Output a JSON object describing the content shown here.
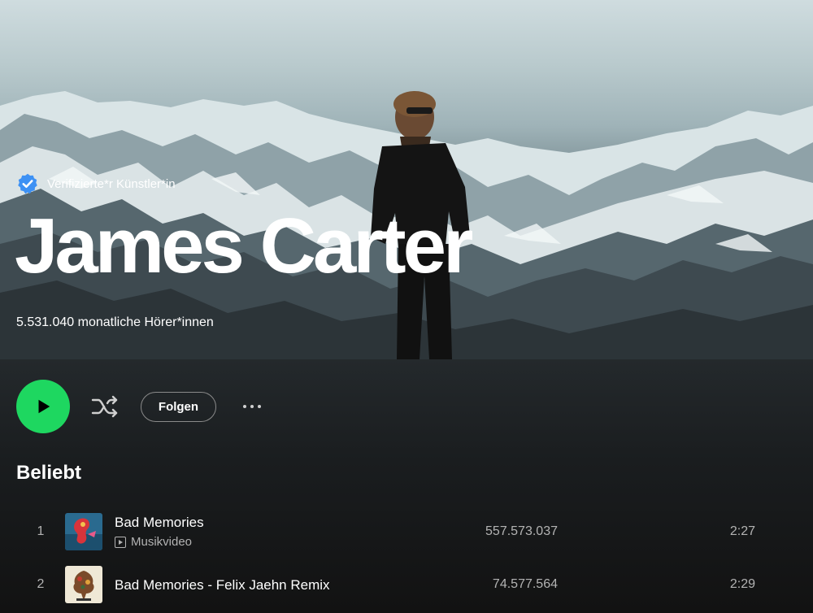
{
  "artist": {
    "verified_label": "Verifizierte*r Künstler*in",
    "name": "James Carter",
    "monthly_listeners": "5.531.040 monatliche Hörer*innen"
  },
  "actions": {
    "follow_label": "Folgen"
  },
  "popular": {
    "title": "Beliebt",
    "tracks": [
      {
        "number": "1",
        "title": "Bad Memories",
        "badge": "Musikvideo",
        "plays": "557.573.037",
        "duration": "2:27"
      },
      {
        "number": "2",
        "title": "Bad Memories - Felix Jaehn Remix",
        "plays": "74.577.564",
        "duration": "2:29"
      }
    ]
  },
  "colors": {
    "accent": "#1ed760",
    "verified_badge": "#3d91f4",
    "background": "#121212",
    "text_secondary": "#b3b3b3"
  },
  "icons": {
    "verified": "verified-badge-icon",
    "play": "play-icon",
    "shuffle": "shuffle-icon",
    "more": "more-options-icon",
    "video": "video-icon"
  }
}
